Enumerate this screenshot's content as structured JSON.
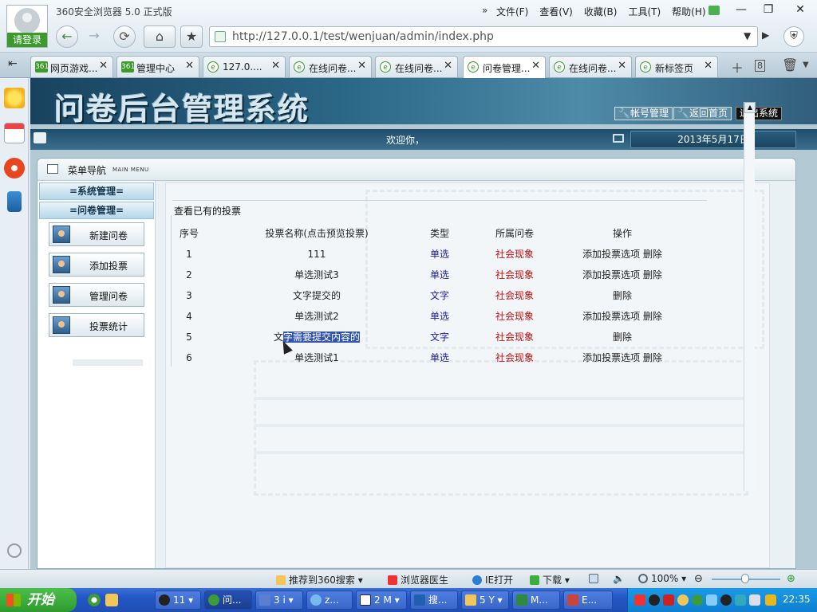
{
  "browser": {
    "title": "360安全浏览器 5.0 正式版",
    "login_label": "请登录",
    "menu_chevrons": "»",
    "menu": [
      "文件(F)",
      "查看(V)",
      "收藏(B)",
      "工具(T)",
      "帮助(H)"
    ],
    "url": "http://127.0.0.1/test/wenjuan/admin/index.php",
    "tabs": [
      {
        "label": "网页游戏...",
        "icon": "361",
        "active": false
      },
      {
        "label": "管理中心",
        "icon": "361",
        "active": false
      },
      {
        "label": "127.0....",
        "icon": "e",
        "active": false
      },
      {
        "label": "在线问卷...",
        "icon": "e",
        "active": false
      },
      {
        "label": "在线问卷...",
        "icon": "e",
        "active": false
      },
      {
        "label": "问卷管理...",
        "icon": "e",
        "active": true
      },
      {
        "label": "在线问卷...",
        "icon": "e",
        "active": false
      },
      {
        "label": "新标签页",
        "icon": "e",
        "active": false
      }
    ],
    "tab_count_badge": "8"
  },
  "page": {
    "system_title": "问卷后台管理系统",
    "banner_buttons": {
      "account": "帐号管理",
      "home": "返回首页",
      "logout": "退出系统"
    },
    "welcome": "欢迎你，",
    "date": "2013年5月17日",
    "menu_nav": {
      "title": "菜单导航",
      "title_en": "MAIN MENU"
    },
    "sections": {
      "system": "=系统管理=",
      "survey": "=问卷管理="
    },
    "menu_buttons": [
      "新建问卷",
      "添加投票",
      "管理问卷",
      "投票统计"
    ],
    "panel_title": "查看已有的投票",
    "table": {
      "headers": [
        "序号",
        "投票名称(点击预览投票)",
        "类型",
        "所属问卷",
        "操作"
      ],
      "rows": [
        {
          "no": "1",
          "name": "111",
          "type": "单选",
          "survey": "社会现象",
          "op_add": "添加投票选项",
          "op_del": "删除"
        },
        {
          "no": "2",
          "name": "单选测试3",
          "type": "单选",
          "survey": "社会现象",
          "op_add": "添加投票选项",
          "op_del": "删除"
        },
        {
          "no": "3",
          "name": "文字提交的",
          "type": "文字",
          "survey": "社会现象",
          "op_add": "",
          "op_del": "删除"
        },
        {
          "no": "4",
          "name": "单选测试2",
          "type": "单选",
          "survey": "社会现象",
          "op_add": "添加投票选项",
          "op_del": "删除"
        },
        {
          "no": "5",
          "name_plain": "文",
          "name_selected": "字需要提交内容的",
          "type": "文字",
          "survey": "社会现象",
          "op_add": "",
          "op_del": "删除"
        },
        {
          "no": "6",
          "name": "单选测试1",
          "type": "单选",
          "survey": "社会现象",
          "op_add": "添加投票选项",
          "op_del": "删除"
        }
      ]
    }
  },
  "statusbar": {
    "recommend": "推荐到360搜索",
    "doctor": "浏览器医生",
    "ie_open": "IE打开",
    "download": "下载",
    "zoom": "100%"
  },
  "taskbar": {
    "start": "开始",
    "tasks": [
      "11",
      "问...",
      "3 i",
      "z...",
      "2 M",
      "搜...",
      "5 Y",
      "M...",
      "E..."
    ],
    "clock": "22:35"
  },
  "colors": {
    "type_text": "#1a1aa8",
    "survey_text": "#c01010",
    "banner": "#2b6787",
    "start_green": "#3a9a2a"
  }
}
